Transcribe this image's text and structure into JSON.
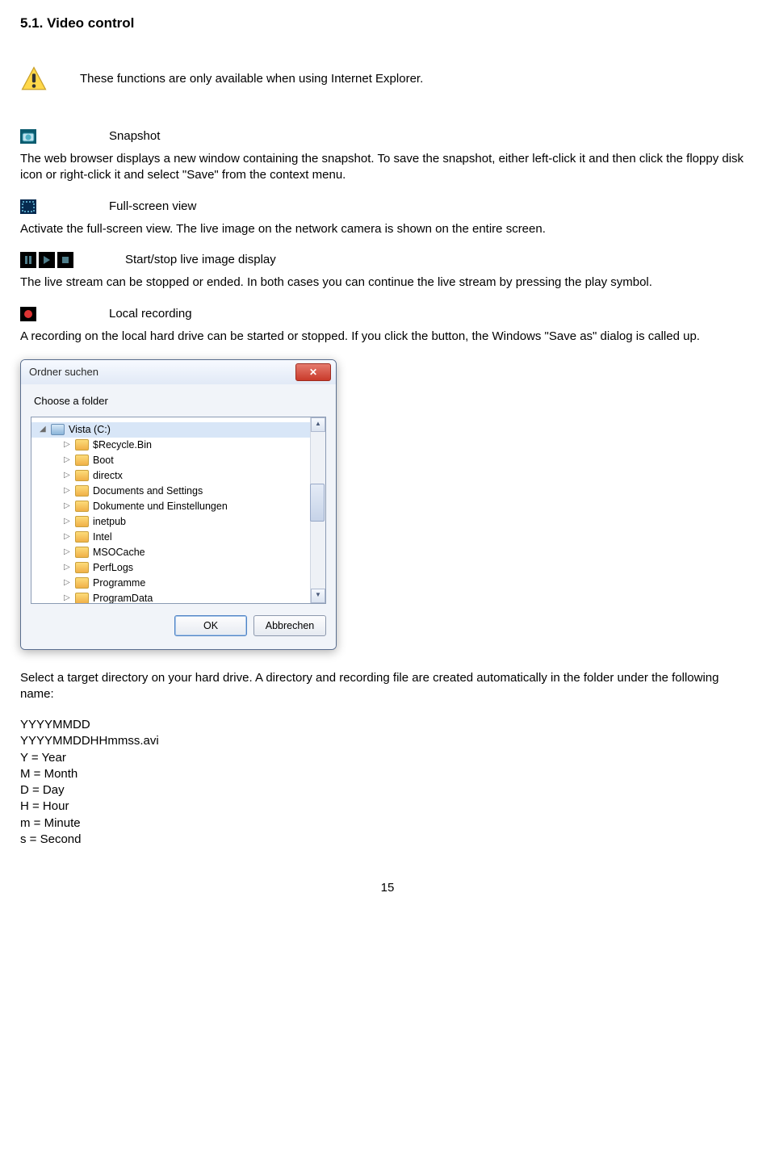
{
  "heading": "5.1.    Video control",
  "warn_note": "These functions are only available when using Internet Explorer.",
  "snapshot": {
    "label": "Snapshot",
    "desc": "The web browser displays a new window containing the snapshot. To save the snapshot, either left-click it and then click the floppy disk icon or right-click it and select \"Save\" from the context menu."
  },
  "fullscreen": {
    "label": "Full-screen view",
    "desc": "Activate the full-screen view. The live image on the network camera is shown on the entire screen."
  },
  "playback": {
    "label": "Start/stop live image display",
    "desc": "The live stream can be stopped or ended. In both cases you can continue the live stream by pressing the play symbol."
  },
  "recording": {
    "label": "Local recording",
    "desc": "A recording on the local hard drive can be started or stopped. If you click the button, the Windows \"Save as\" dialog is called up."
  },
  "dialog": {
    "title": "Ordner suchen",
    "prompt": "Choose a folder",
    "drive": "Vista (C:)",
    "folders": [
      "$Recycle.Bin",
      "Boot",
      "directx",
      "Documents and Settings",
      "Dokumente und Einstellungen",
      "inetpub",
      "Intel",
      "MSOCache",
      "PerfLogs",
      "Programme",
      "ProgramData"
    ],
    "ok": "OK",
    "cancel": "Abbrechen"
  },
  "after_dialog": "Select a target directory on your hard drive. A directory and recording file are created automatically in the folder under the following name:",
  "format": {
    "l1": "YYYYMMDD",
    "l2": "YYYYMMDDHHmmss.avi",
    "l3": "Y = Year",
    "l4": "M = Month",
    "l5": "D = Day",
    "l6": "H = Hour",
    "l7": "m = Minute",
    "l8": "s = Second"
  },
  "page_number": "15"
}
